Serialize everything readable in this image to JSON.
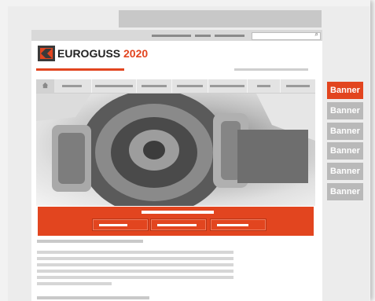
{
  "brand": {
    "name": "EUROGUSS",
    "year": "2020"
  },
  "banners": [
    "Banner",
    "Banner",
    "Banner",
    "Banner",
    "Banner",
    "Banner"
  ],
  "colors": {
    "accent": "#e2451f",
    "banner_active": "#e2451f",
    "banner_inactive": "#b9b9b9"
  },
  "icons": {
    "search": "magnifier",
    "home": "house"
  }
}
